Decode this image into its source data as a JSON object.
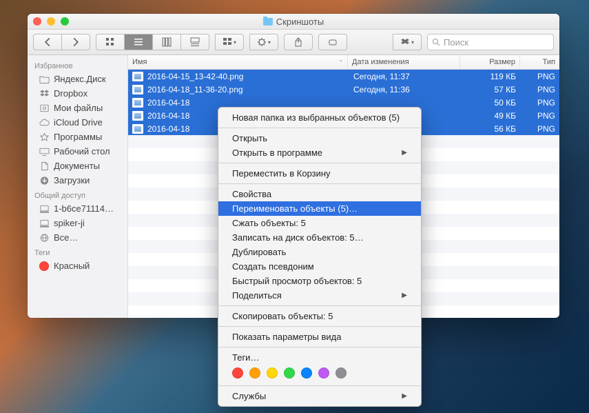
{
  "window": {
    "title": "Скриншоты"
  },
  "toolbar": {
    "search_placeholder": "Поиск"
  },
  "sidebar": {
    "sections": [
      {
        "label": "Избранное",
        "items": [
          {
            "label": "Яндекс.Диск",
            "icon": "folder"
          },
          {
            "label": "Dropbox",
            "icon": "dropbox"
          },
          {
            "label": "Мои файлы",
            "icon": "all-files"
          },
          {
            "label": "iCloud Drive",
            "icon": "cloud"
          },
          {
            "label": "Программы",
            "icon": "apps"
          },
          {
            "label": "Рабочий стол",
            "icon": "desktop"
          },
          {
            "label": "Документы",
            "icon": "documents"
          },
          {
            "label": "Загрузки",
            "icon": "downloads"
          }
        ]
      },
      {
        "label": "Общий доступ",
        "items": [
          {
            "label": "1-b6ce71114…",
            "icon": "computer"
          },
          {
            "label": "spiker-ji",
            "icon": "computer"
          },
          {
            "label": "Все…",
            "icon": "globe"
          }
        ]
      },
      {
        "label": "Теги",
        "items": [
          {
            "label": "Красный",
            "icon": "tag-red"
          }
        ]
      }
    ]
  },
  "columns": {
    "name": "Имя",
    "date": "Дата изменения",
    "size": "Размер",
    "type": "Тип"
  },
  "files": [
    {
      "name": "2016-04-15_13-42-40.png",
      "date": "Сегодня, 11:37",
      "size": "119 КБ",
      "type": "PNG"
    },
    {
      "name": "2016-04-18_11-36-20.png",
      "date": "Сегодня, 11:36",
      "size": "57 КБ",
      "type": "PNG"
    },
    {
      "name": "2016-04-18",
      "date": "",
      "size": "50 КБ",
      "type": "PNG"
    },
    {
      "name": "2016-04-18",
      "date": "",
      "size": "49 КБ",
      "type": "PNG"
    },
    {
      "name": "2016-04-18",
      "date": "",
      "size": "56 КБ",
      "type": "PNG"
    }
  ],
  "context_menu": {
    "items": [
      {
        "label": "Новая папка из выбранных объектов (5)"
      },
      {
        "sep": true
      },
      {
        "label": "Открыть"
      },
      {
        "label": "Открыть в программе",
        "submenu": true
      },
      {
        "sep": true
      },
      {
        "label": "Переместить в Корзину"
      },
      {
        "sep": true
      },
      {
        "label": "Свойства"
      },
      {
        "label": "Переименовать объекты (5)…",
        "highlighted": true
      },
      {
        "label": "Сжать объекты: 5"
      },
      {
        "label": "Записать на диск объектов: 5…"
      },
      {
        "label": "Дублировать"
      },
      {
        "label": "Создать псевдоним"
      },
      {
        "label": "Быстрый просмотр объектов: 5"
      },
      {
        "label": "Поделиться",
        "submenu": true
      },
      {
        "sep": true
      },
      {
        "label": "Скопировать объекты: 5"
      },
      {
        "sep": true
      },
      {
        "label": "Показать параметры вида"
      },
      {
        "sep": true
      },
      {
        "label": "Теги…"
      },
      {
        "tags": true,
        "colors": [
          "#ff453a",
          "#ff9f0a",
          "#ffd60a",
          "#32d74b",
          "#0a84ff",
          "#bf5af2",
          "#8e8e93"
        ]
      },
      {
        "sep": true
      },
      {
        "label": "Службы",
        "submenu": true
      }
    ]
  }
}
